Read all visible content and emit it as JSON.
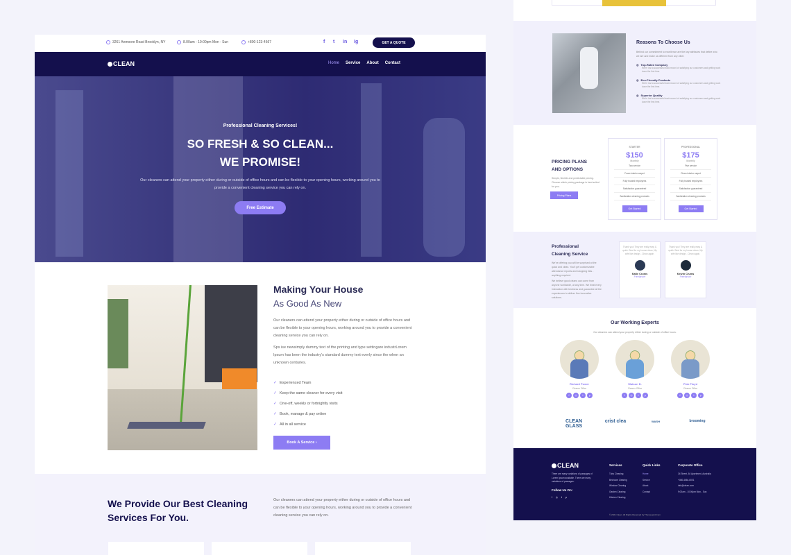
{
  "topbar": {
    "address": "3261 Anmoore Road Brooklyn, NY",
    "hours": "8.00am - 10:00pm Mon - Sun",
    "phone": "+800-123-4567",
    "social": [
      "f",
      "t",
      "in",
      "ig"
    ],
    "quote_button": "GET A QUOTE"
  },
  "navbar": {
    "logo": "CLEAN",
    "links": [
      {
        "label": "Home",
        "active": true
      },
      {
        "label": "Service",
        "active": false
      },
      {
        "label": "About",
        "active": false
      },
      {
        "label": "Contact",
        "active": false
      }
    ]
  },
  "hero": {
    "subtitle": "Professional Cleaning Services!",
    "title_line1": "SO FRESH & SO CLEAN...",
    "title_line2": "WE PROMISE!",
    "description": "Our cleaners can attend your property either during or outside of office hours and can be flexible to your opening hours, working around you to provide a convenient cleaning service you can rely on.",
    "button": "Free Estimate"
  },
  "about": {
    "title_line1": "Making Your House",
    "title_line2": "As Good As New",
    "paragraph1": "Our cleaners can attend your property either during or outside of office hours and can be flexible to your opening hours, working around you to provide a convenient cleaning service you can rely on.",
    "paragraph2": "Sps ise newsimply dummy text of the printing and type settingare industrLorem Ipsum has been the industry's standard dummy text everly since the when an unknown centuries.",
    "list": [
      "Experienced Team",
      "Keep the same cleaner for every visit",
      "One-off, weekly or fortnightly visits",
      "Book, manage & pay online",
      "All in all service"
    ],
    "button": "Book A Service ›"
  },
  "services": {
    "title": "We Provide Our Best Cleaning Services For You.",
    "description": "Our cleaners can attend your property either during or outside of office hours and can be flexible to your opening hours, working around you to provide a convenient cleaning service you can rely on."
  },
  "reasons": {
    "title": "Reasons To Choose Us",
    "intro": "Behind our commitment to excellence are the key attributes that define who we are and make us different from any other.",
    "items": [
      {
        "title": "Top-Rated Company",
        "desc": "We're lost a successful track record of satisfying our customers and getting work done the first time."
      },
      {
        "title": "Eco-Friendly Products",
        "desc": "We're lost a successful track record of satisfying our customers and getting work done the first time."
      },
      {
        "title": "Superior Quality",
        "desc": "We're lost a successful track record of satisfying our customers and getting work done the first time."
      }
    ]
  },
  "pricing": {
    "title_line1": "PRICING PLANS",
    "title_line2": "AND OPTIONS",
    "desc": "Simple, flexible and predictable pricing. Choose which pricing package is best suited for you.",
    "button": "Pricing Plans",
    "plans": [
      {
        "label": "STARTER",
        "price": "$150",
        "period": "Monthly",
        "features": [
          "Two service",
          "Foam interior carpet",
          "Fully trusted employees",
          "Satisfaction guaranteed",
          "Sanitization cleaning products"
        ],
        "button": "Get Started"
      },
      {
        "label": "PROFESSIONAL",
        "price": "$175",
        "period": "Monthly",
        "features": [
          "Five service",
          "Clean interior carpet",
          "Fully trusted employees",
          "Satisfaction guaranteed",
          "Sanitization cleaning products"
        ],
        "button": "Get Started"
      }
    ]
  },
  "testimonials": {
    "title_line1": "Professional",
    "title_line2": "Cleaning Service",
    "p1": "We've offering you will be surprised at the quick and clean. You'll get customizable attendance reports and shopping lists - anything required.",
    "p2": "We believe good cleans can come from anyone worldwide, at any time. We treat every interaction with kindness and guarantee all the experiences to deliver fine innovative solutions.",
    "items": [
      {
        "quote": "Thank you! They are really easy & quick. Best for my house clean, My wife like design - Clean again.",
        "name": "Katie Crums",
        "role": "Freelancer"
      },
      {
        "quote": "Thank you! They are really easy & quick. Best for my house clean, My wife like design - Clean again.",
        "name": "Kelvin Crums",
        "role": "Freelancer"
      }
    ]
  },
  "experts": {
    "title": "Our Working Experts",
    "subtitle": "Our cleaners can attend your property either during or outside of office hours.",
    "items": [
      {
        "name": "Richard Power",
        "role": "Cleaner Office"
      },
      {
        "name": "Watson D.",
        "role": "Cleaner Office"
      },
      {
        "name": "Pink Floyd",
        "role": "Cleaner Office"
      }
    ]
  },
  "brands": [
    "CLEAN GLASS",
    "crist clea",
    "WASH",
    "brooming"
  ],
  "footer": {
    "logo": "CLEAN",
    "about": "There are many variations of passages of Lorem Ipsum available. There are many variations of passages.",
    "follow": "Follow Us On:",
    "services_title": "Services",
    "services": [
      "Tubs Cleaning",
      "Bedroom Clearing",
      "Window Clearing",
      "Garden Clearing",
      "Kitchen Clearing"
    ],
    "quick_title": "Quick Links",
    "quick": [
      "Home",
      "Service",
      "About",
      "Contact"
    ],
    "office_title": "Corporate Office",
    "office": [
      "34 Street, 64 Apartment, Australia",
      "+080-4664-6001",
      "info@clean.com",
      "9:00am - 10:00pm Mon - Sun"
    ],
    "copyright": "© 2021 Clean. All Rights Reserved by Themeops4.Com"
  }
}
